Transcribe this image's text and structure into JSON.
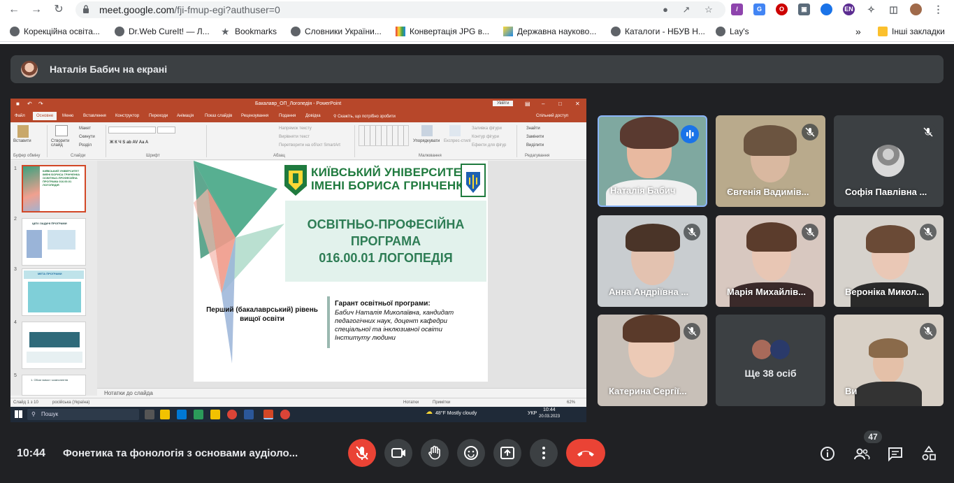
{
  "browser": {
    "url_host": "meet.google.com",
    "url_path": "/fji-fmup-egi?authuser=0",
    "profile_badge": "EN",
    "bookmarks": [
      {
        "label": "Корекційна освіта..."
      },
      {
        "label": "Dr.Web CureIt! — Л..."
      },
      {
        "label": "Bookmarks"
      },
      {
        "label": "Словники України..."
      },
      {
        "label": "Конвертація JPG в..."
      },
      {
        "label": "Державна науково..."
      },
      {
        "label": "Каталоги - НБУВ Н..."
      },
      {
        "label": "Lay's"
      }
    ],
    "more": "»",
    "other_bookmarks": "Інші закладки"
  },
  "presenting": {
    "text": "Наталія Бабич на екрані"
  },
  "powerpoint": {
    "title": "Бакалавр_ОП_Логопедія  -  PowerPoint",
    "signin": "Увійти",
    "tabs": [
      "Файл",
      "Основне",
      "Меню",
      "Вставлення",
      "Конструктор",
      "Переходи",
      "Анімація",
      "Показ слайдів",
      "Рецензування",
      "Подання",
      "Довідка"
    ],
    "tell_me": "Скажіть, що потрібно зробити",
    "share": "Спільний доступ",
    "ribbon": {
      "paste": "Вставити",
      "new_slide": "Створити слайд",
      "layout": "Макет",
      "reset": "Скинути",
      "section": "Розділ",
      "groups": [
        "Буфер обміну",
        "Слайди",
        "Шрифт",
        "Абзац",
        "Малювання",
        "Редагування"
      ],
      "arrange": "Упорядкувати",
      "quick_styles": "Експрес-стилі",
      "find": "Знайти",
      "replace": "Замінити",
      "select": "Виділити",
      "text_direction": "Напрямок тексту",
      "align_text": "Вирівняти текст",
      "smartart": "Перетворити на об'єкт SmartArt",
      "fill": "Заливка фігури",
      "outline": "Контур фігури",
      "effects": "Ефекти для фігур"
    },
    "thumbnails": [
      {
        "num": "1",
        "text": "КИЇВСЬКИЙ УНІВЕРСИТЕТ ІМЕНІ БОРИСА ГРІНЧЕНКА ОСВІТНЬО-ПРОФЕСІЙНА ПРОГРАМА 016.00.01 ЛОГОПЕДІЯ"
      },
      {
        "num": "2",
        "text": "ЦІЛІ І ЗАДАЧІ ПРОГРАМИ"
      },
      {
        "num": "3",
        "text": "МЕТА ПРОГРАМИ"
      },
      {
        "num": "4",
        "text": ""
      },
      {
        "num": "5",
        "text": "1. Обсяг вимог і компонентів"
      }
    ],
    "slide": {
      "university": "КИЇВСЬКИЙ УНІВЕРСИТЕТ ІМЕНІ БОРИСА ГРІНЧЕНКА",
      "program_lines": [
        "ОСВІТНЬО-ПРОФЕСІЙНА",
        "ПРОГРАМА",
        "016.00.01 ЛОГОПЕДІЯ"
      ],
      "level": "Перший (бакалаврський) рівень вищої освіти",
      "guarantor_title": "Гарант освітньої програми:",
      "guarantor_text": "Бабич Наталія Миколаївна, кандидат педагогічних наук, доцент кафедри спеціальної та інклюзивної освіти Інституту людини"
    },
    "notes": "Нотатки до слайда",
    "status_slide": "Слайд 1 з 10",
    "status_lang": "російська (Україна)",
    "status_notes": "Нотатки",
    "status_comments": "Примітки",
    "zoom": "62%"
  },
  "taskbar": {
    "search": "Пошук",
    "weather": "48°F  Mostly cloudy",
    "lang": "УКР",
    "time": "10:44",
    "date": "20.03.2023"
  },
  "participants": [
    {
      "name": "Наталія Бабич",
      "speaking": true
    },
    {
      "name": "Євгенія Вадимів...",
      "muted": true
    },
    {
      "name": "Софія Павлівна ...",
      "muted": true
    },
    {
      "name": "Анна Андріївна ...",
      "muted": true
    },
    {
      "name": "Марія Михайлів...",
      "muted": true
    },
    {
      "name": "Вероніка Микол...",
      "muted": true
    },
    {
      "name": "Катерина Сергії...",
      "muted": true
    },
    {
      "name": "Ще 38 осіб"
    },
    {
      "name": "Ви",
      "muted": true
    }
  ],
  "bottom_bar": {
    "time": "10:44",
    "meeting_title": "Фонетика та фонологія з основами аудіоло...",
    "participant_count": "47"
  },
  "colors": {
    "meet_bg": "#202124",
    "end_call": "#ea4335",
    "ppt_accent": "#b7472a",
    "slide_green": "#2e7d55"
  },
  "icons": [
    "lock-icon",
    "camera-off-icon",
    "share-icon",
    "star-icon",
    "puzzle-icon",
    "mic-off-icon",
    "hand-icon",
    "emoji-icon",
    "present-icon",
    "more-icon",
    "end-call-icon",
    "info-icon",
    "people-icon",
    "chat-icon",
    "activities-icon"
  ]
}
